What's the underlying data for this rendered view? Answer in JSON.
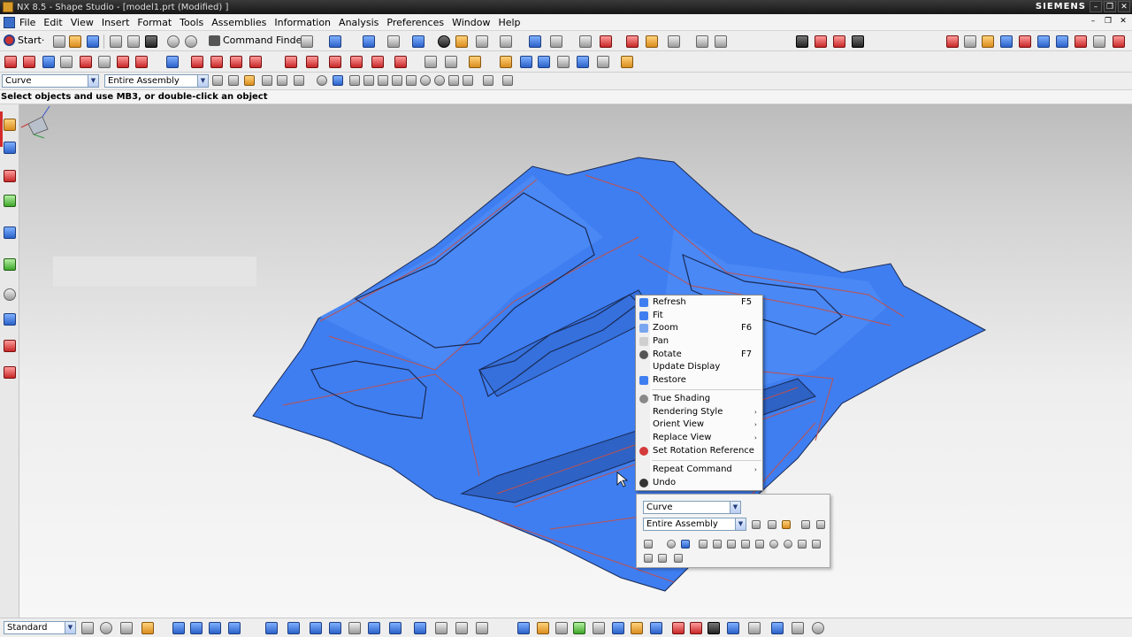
{
  "window": {
    "title": "NX 8.5 - Shape Studio - [model1.prt (Modified) ]",
    "brand": "SIEMENS",
    "controls": [
      "–",
      "❐",
      "✕"
    ]
  },
  "menubar": {
    "items": [
      "File",
      "Edit",
      "View",
      "Insert",
      "Format",
      "Tools",
      "Assemblies",
      "Information",
      "Analysis",
      "Preferences",
      "Window",
      "Help"
    ],
    "doc_controls": [
      "–",
      "❐",
      "✕"
    ]
  },
  "toolbar": {
    "start_label": "Start·",
    "command_finder_label": "Command Finder"
  },
  "selection_bar": {
    "type_filter": "Curve",
    "scope": "Entire Assembly"
  },
  "cue_line": {
    "text": "Select objects and use MB3, or double-click an object"
  },
  "context_menu": {
    "items": [
      {
        "label": "Refresh",
        "shortcut": "F5",
        "icon": "refresh-icon"
      },
      {
        "label": "Fit",
        "shortcut": "",
        "icon": "fit-icon"
      },
      {
        "label": "Zoom",
        "shortcut": "F6",
        "icon": "zoom-icon"
      },
      {
        "label": "Pan",
        "shortcut": "",
        "icon": "pan-icon"
      },
      {
        "label": "Rotate",
        "shortcut": "F7",
        "icon": "rotate-icon"
      },
      {
        "label": "Update Display",
        "shortcut": "",
        "icon": ""
      },
      {
        "label": "Restore",
        "shortcut": "",
        "icon": "restore-icon"
      },
      {
        "label": "True Shading",
        "shortcut": "",
        "icon": "true-shading-icon"
      },
      {
        "label": "Rendering Style",
        "shortcut": "",
        "icon": "",
        "submenu": "›"
      },
      {
        "label": "Orient View",
        "shortcut": "",
        "icon": "",
        "submenu": "›"
      },
      {
        "label": "Replace View",
        "shortcut": "",
        "icon": "",
        "submenu": "›"
      },
      {
        "label": "Set Rotation Reference",
        "shortcut": "",
        "icon": "rotation-reference-icon"
      },
      {
        "label": "Repeat Command",
        "shortcut": "",
        "icon": "",
        "submenu": "›"
      },
      {
        "label": "Undo",
        "shortcut": "",
        "icon": "undo-icon"
      }
    ]
  },
  "minibar": {
    "type_filter": "Curve",
    "scope": "Entire Assembly"
  },
  "bottom_toolbar": {
    "view_combo": "Standard"
  },
  "colors": {
    "model_blue": "#3f7ef0",
    "model_edge": "#c0504d",
    "model_outline": "#1a2a55",
    "title_bar": "#1f1f1f"
  }
}
